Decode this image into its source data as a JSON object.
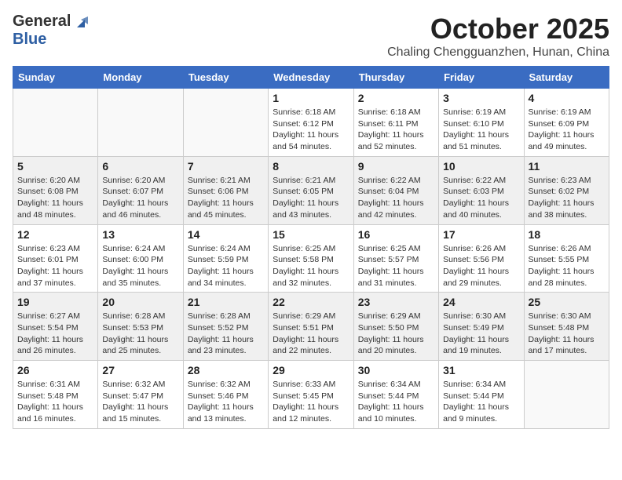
{
  "header": {
    "logo_general": "General",
    "logo_blue": "Blue",
    "month": "October 2025",
    "location": "Chaling Chengguanzhen, Hunan, China"
  },
  "weekdays": [
    "Sunday",
    "Monday",
    "Tuesday",
    "Wednesday",
    "Thursday",
    "Friday",
    "Saturday"
  ],
  "weeks": [
    [
      {
        "day": "",
        "info": ""
      },
      {
        "day": "",
        "info": ""
      },
      {
        "day": "",
        "info": ""
      },
      {
        "day": "1",
        "info": "Sunrise: 6:18 AM\nSunset: 6:12 PM\nDaylight: 11 hours\nand 54 minutes."
      },
      {
        "day": "2",
        "info": "Sunrise: 6:18 AM\nSunset: 6:11 PM\nDaylight: 11 hours\nand 52 minutes."
      },
      {
        "day": "3",
        "info": "Sunrise: 6:19 AM\nSunset: 6:10 PM\nDaylight: 11 hours\nand 51 minutes."
      },
      {
        "day": "4",
        "info": "Sunrise: 6:19 AM\nSunset: 6:09 PM\nDaylight: 11 hours\nand 49 minutes."
      }
    ],
    [
      {
        "day": "5",
        "info": "Sunrise: 6:20 AM\nSunset: 6:08 PM\nDaylight: 11 hours\nand 48 minutes."
      },
      {
        "day": "6",
        "info": "Sunrise: 6:20 AM\nSunset: 6:07 PM\nDaylight: 11 hours\nand 46 minutes."
      },
      {
        "day": "7",
        "info": "Sunrise: 6:21 AM\nSunset: 6:06 PM\nDaylight: 11 hours\nand 45 minutes."
      },
      {
        "day": "8",
        "info": "Sunrise: 6:21 AM\nSunset: 6:05 PM\nDaylight: 11 hours\nand 43 minutes."
      },
      {
        "day": "9",
        "info": "Sunrise: 6:22 AM\nSunset: 6:04 PM\nDaylight: 11 hours\nand 42 minutes."
      },
      {
        "day": "10",
        "info": "Sunrise: 6:22 AM\nSunset: 6:03 PM\nDaylight: 11 hours\nand 40 minutes."
      },
      {
        "day": "11",
        "info": "Sunrise: 6:23 AM\nSunset: 6:02 PM\nDaylight: 11 hours\nand 38 minutes."
      }
    ],
    [
      {
        "day": "12",
        "info": "Sunrise: 6:23 AM\nSunset: 6:01 PM\nDaylight: 11 hours\nand 37 minutes."
      },
      {
        "day": "13",
        "info": "Sunrise: 6:24 AM\nSunset: 6:00 PM\nDaylight: 11 hours\nand 35 minutes."
      },
      {
        "day": "14",
        "info": "Sunrise: 6:24 AM\nSunset: 5:59 PM\nDaylight: 11 hours\nand 34 minutes."
      },
      {
        "day": "15",
        "info": "Sunrise: 6:25 AM\nSunset: 5:58 PM\nDaylight: 11 hours\nand 32 minutes."
      },
      {
        "day": "16",
        "info": "Sunrise: 6:25 AM\nSunset: 5:57 PM\nDaylight: 11 hours\nand 31 minutes."
      },
      {
        "day": "17",
        "info": "Sunrise: 6:26 AM\nSunset: 5:56 PM\nDaylight: 11 hours\nand 29 minutes."
      },
      {
        "day": "18",
        "info": "Sunrise: 6:26 AM\nSunset: 5:55 PM\nDaylight: 11 hours\nand 28 minutes."
      }
    ],
    [
      {
        "day": "19",
        "info": "Sunrise: 6:27 AM\nSunset: 5:54 PM\nDaylight: 11 hours\nand 26 minutes."
      },
      {
        "day": "20",
        "info": "Sunrise: 6:28 AM\nSunset: 5:53 PM\nDaylight: 11 hours\nand 25 minutes."
      },
      {
        "day": "21",
        "info": "Sunrise: 6:28 AM\nSunset: 5:52 PM\nDaylight: 11 hours\nand 23 minutes."
      },
      {
        "day": "22",
        "info": "Sunrise: 6:29 AM\nSunset: 5:51 PM\nDaylight: 11 hours\nand 22 minutes."
      },
      {
        "day": "23",
        "info": "Sunrise: 6:29 AM\nSunset: 5:50 PM\nDaylight: 11 hours\nand 20 minutes."
      },
      {
        "day": "24",
        "info": "Sunrise: 6:30 AM\nSunset: 5:49 PM\nDaylight: 11 hours\nand 19 minutes."
      },
      {
        "day": "25",
        "info": "Sunrise: 6:30 AM\nSunset: 5:48 PM\nDaylight: 11 hours\nand 17 minutes."
      }
    ],
    [
      {
        "day": "26",
        "info": "Sunrise: 6:31 AM\nSunset: 5:48 PM\nDaylight: 11 hours\nand 16 minutes."
      },
      {
        "day": "27",
        "info": "Sunrise: 6:32 AM\nSunset: 5:47 PM\nDaylight: 11 hours\nand 15 minutes."
      },
      {
        "day": "28",
        "info": "Sunrise: 6:32 AM\nSunset: 5:46 PM\nDaylight: 11 hours\nand 13 minutes."
      },
      {
        "day": "29",
        "info": "Sunrise: 6:33 AM\nSunset: 5:45 PM\nDaylight: 11 hours\nand 12 minutes."
      },
      {
        "day": "30",
        "info": "Sunrise: 6:34 AM\nSunset: 5:44 PM\nDaylight: 11 hours\nand 10 minutes."
      },
      {
        "day": "31",
        "info": "Sunrise: 6:34 AM\nSunset: 5:44 PM\nDaylight: 11 hours\nand 9 minutes."
      },
      {
        "day": "",
        "info": ""
      }
    ]
  ]
}
